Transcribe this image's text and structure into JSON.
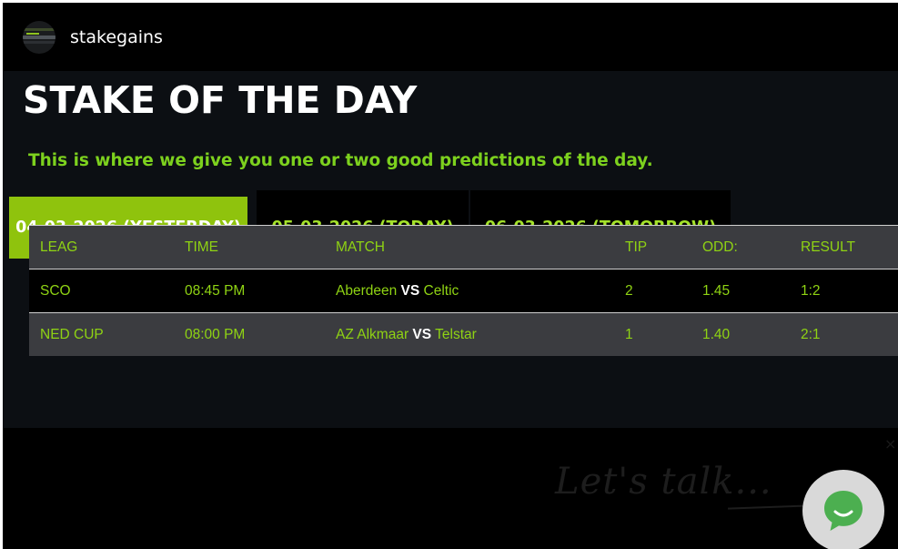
{
  "header": {
    "brand_name": "stakegains",
    "avatar_icon": "site-logo-icon"
  },
  "page": {
    "title": "STAKE OF THE DAY",
    "subtitle": "This is where we give you one or two good predictions of the day."
  },
  "tabs": [
    {
      "label": "04-03-2026 (YESTERDAY)",
      "active": true
    },
    {
      "label": "05-03-2026 (TODAY)",
      "active": false
    },
    {
      "label": "06-03-2026 (TOMORROW)",
      "active": false
    }
  ],
  "table": {
    "columns": [
      "LEAG",
      "TIME",
      "MATCH",
      "TIP",
      "ODD:",
      "RESULT"
    ],
    "rows": [
      {
        "league": "SCO",
        "time": "08:45 PM",
        "home": "Aberdeen",
        "vs": "VS",
        "away": "Celtic",
        "tip": "2",
        "odd": "1.45",
        "result": "1:2"
      },
      {
        "league": "NED CUP",
        "time": "08:00 PM",
        "home": "AZ Alkmaar",
        "vs": "VS",
        "away": "Telstar",
        "tip": "1",
        "odd": "1.40",
        "result": "2:1"
      }
    ]
  },
  "chat_widget": {
    "caption": "Let's talk...",
    "close_glyph": "×",
    "icon": "chat-bubble-icon"
  },
  "colors": {
    "accent_green": "#8fc30d",
    "text_green": "#7dd11e",
    "background": "#0c0f13"
  }
}
